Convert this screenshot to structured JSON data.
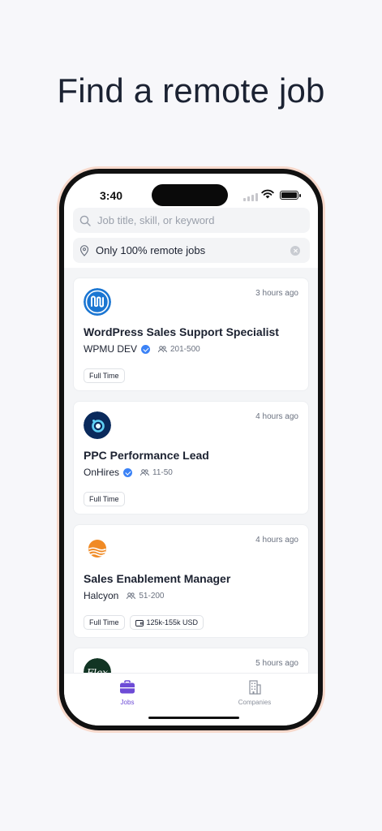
{
  "headline": "Find a remote job",
  "status_bar": {
    "time": "3:40"
  },
  "search": {
    "placeholder": "Job title, skill, or keyword"
  },
  "filter": {
    "value": "Only 100% remote jobs"
  },
  "jobs": [
    {
      "posted": "3 hours ago",
      "title": "WordPress Sales Support Specialist",
      "company": "WPMU DEV",
      "verified": true,
      "size": "201-500",
      "tags": [
        "Full Time"
      ],
      "salary": null,
      "logo_color": "#1b76d2"
    },
    {
      "posted": "4 hours ago",
      "title": "PPC Performance Lead",
      "company": "OnHires",
      "verified": true,
      "size": "11-50",
      "tags": [
        "Full Time"
      ],
      "salary": null,
      "logo_color": "#0a2a5c"
    },
    {
      "posted": "4 hours ago",
      "title": "Sales Enablement Manager",
      "company": "Halcyon",
      "verified": false,
      "size": "51-200",
      "tags": [
        "Full Time"
      ],
      "salary": "125k-155k USD",
      "logo_color": "#f08a24"
    },
    {
      "posted": "5 hours ago",
      "logo_text": "Flex",
      "logo_color": "#123524"
    }
  ],
  "tabs": {
    "jobs": "Jobs",
    "companies": "Companies"
  },
  "colors": {
    "accent": "#6d4bd6",
    "verified": "#3b82f6",
    "frame_glow": "#f7d9cc"
  }
}
